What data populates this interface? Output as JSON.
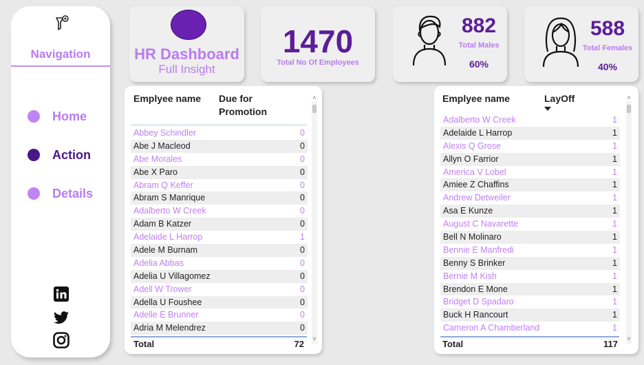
{
  "nav": {
    "title": "Navigation",
    "pin_icon": "pin-icon",
    "items": [
      {
        "label": "Home",
        "color": "#b97cf0",
        "dot": "#c084f5"
      },
      {
        "label": "Action",
        "color": "#4a168a",
        "dot": "#4a168a"
      },
      {
        "label": "Details",
        "color": "#b97cf0",
        "dot": "#c084f5"
      }
    ],
    "social": [
      "linkedin-icon",
      "twitter-icon",
      "instagram-icon"
    ]
  },
  "title_card": {
    "title": "HR Dashboard",
    "subtitle": "Full Insight"
  },
  "kpi_total": {
    "value": "1470",
    "caption": "Total No Of Employees"
  },
  "kpi_male": {
    "value": "882",
    "caption": "Total Males",
    "percent": "60%"
  },
  "kpi_female": {
    "value": "588",
    "caption": "Total Females",
    "percent": "40%"
  },
  "promo_table": {
    "col1": "Emplyee name",
    "col2": "Due for Promotion",
    "rows": [
      [
        "Abbey Schindler",
        "0"
      ],
      [
        "Abe J Macleod",
        "0"
      ],
      [
        "Abe Morales",
        "0"
      ],
      [
        "Abe X Paro",
        "0"
      ],
      [
        "Abram Q Keffer",
        "0"
      ],
      [
        "Abram S Manrique",
        "0"
      ],
      [
        "Adalberto W Creek",
        "0"
      ],
      [
        "Adam B Katzer",
        "0"
      ],
      [
        "Adelaide L Harrop",
        "1"
      ],
      [
        "Adele M Burnam",
        "0"
      ],
      [
        "Adelia Abbas",
        "0"
      ],
      [
        "Adelia U Villagomez",
        "0"
      ],
      [
        "Adell W Trower",
        "0"
      ],
      [
        "Adella U Foushee",
        "0"
      ],
      [
        "Adelle E Brunner",
        "0"
      ],
      [
        "Adria M Melendrez",
        "0"
      ]
    ],
    "total_label": "Total",
    "total_value": "72"
  },
  "layoff_table": {
    "col1": "Emplyee name",
    "col2": "LayOff",
    "rows": [
      [
        "Adalberto W Creek",
        "1"
      ],
      [
        "Adelaide L Harrop",
        "1"
      ],
      [
        "Alexis Q Grose",
        "1"
      ],
      [
        "Allyn O Farrior",
        "1"
      ],
      [
        "America V Lobel",
        "1"
      ],
      [
        "Amiee Z Chaffins",
        "1"
      ],
      [
        "Andrew Detweiler",
        "1"
      ],
      [
        "Asa E Kunze",
        "1"
      ],
      [
        "August C Navarette",
        "1"
      ],
      [
        "Bell N Molinaro",
        "1"
      ],
      [
        "Bennie E Manfredi",
        "1"
      ],
      [
        "Benny S Brinker",
        "1"
      ],
      [
        "Bernie M Kish",
        "1"
      ],
      [
        "Brendon E Mone",
        "1"
      ],
      [
        "Bridget D Spadaro",
        "1"
      ],
      [
        "Buck H Rancourt",
        "1"
      ],
      [
        "Cameron A Chamberland",
        "1"
      ]
    ],
    "total_label": "Total",
    "total_value": "117"
  }
}
